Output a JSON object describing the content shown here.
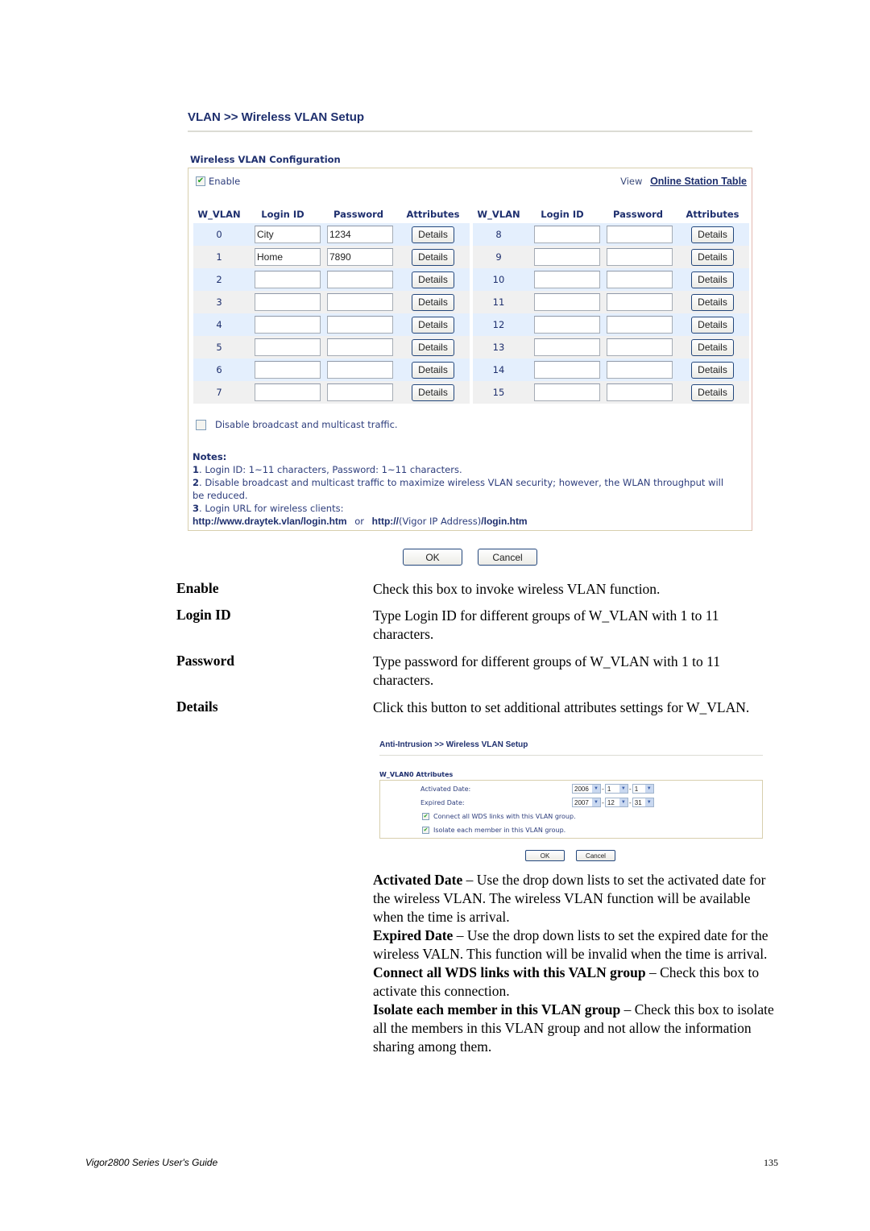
{
  "screenshot1": {
    "title": "VLAN >> Wireless VLAN Setup",
    "section_title": "Wireless VLAN Configuration",
    "enable": {
      "label": "Enable",
      "checked": true
    },
    "view_label": "View",
    "online_station_link": "Online Station Table",
    "columns": [
      "W_VLAN",
      "Login ID",
      "Password",
      "Attributes"
    ],
    "details_label": "Details",
    "left_rows": [
      {
        "id": "0",
        "login": "City",
        "password": "1234"
      },
      {
        "id": "1",
        "login": "Home",
        "password": "7890"
      },
      {
        "id": "2",
        "login": "",
        "password": ""
      },
      {
        "id": "3",
        "login": "",
        "password": ""
      },
      {
        "id": "4",
        "login": "",
        "password": ""
      },
      {
        "id": "5",
        "login": "",
        "password": ""
      },
      {
        "id": "6",
        "login": "",
        "password": ""
      },
      {
        "id": "7",
        "login": "",
        "password": ""
      }
    ],
    "right_rows": [
      {
        "id": "8",
        "login": "",
        "password": ""
      },
      {
        "id": "9",
        "login": "",
        "password": ""
      },
      {
        "id": "10",
        "login": "",
        "password": ""
      },
      {
        "id": "11",
        "login": "",
        "password": ""
      },
      {
        "id": "12",
        "login": "",
        "password": ""
      },
      {
        "id": "13",
        "login": "",
        "password": ""
      },
      {
        "id": "14",
        "login": "",
        "password": ""
      },
      {
        "id": "15",
        "login": "",
        "password": ""
      }
    ],
    "disable_broadcast": {
      "label": "Disable broadcast and multicast traffic.",
      "checked": false
    },
    "notes": {
      "heading": "Notes:",
      "items": [
        {
          "num": "1",
          "text": ". Login ID: 1~11 characters, Password: 1~11 characters."
        },
        {
          "num": "2",
          "text": ". Disable broadcast and multicast traffic to maximize wireless VLAN security; however, the WLAN throughput will be reduced."
        },
        {
          "num": "3",
          "text": ". Login URL for wireless clients:"
        }
      ],
      "url1": "http://www.draytek.vlan/login.htm",
      "or": "or",
      "url2_prefix": "http://",
      "url2_middle": "(Vigor IP Address)",
      "url2_suffix": "/login.htm"
    },
    "ok_label": "OK",
    "cancel_label": "Cancel"
  },
  "definitions": [
    {
      "term": "Enable",
      "desc": "Check this box to invoke wireless VLAN function."
    },
    {
      "term": "Login ID",
      "desc": "Type Login ID for different groups of W_VLAN with 1 to 11 characters."
    },
    {
      "term": "Password",
      "desc": "Type password for different groups of W_VLAN with 1 to 11 characters."
    },
    {
      "term": "Details",
      "desc": "Click this button to set additional attributes settings for W_VLAN."
    }
  ],
  "screenshot2": {
    "title": "Anti-Intrusion >> Wireless VLAN Setup",
    "section_title": "W_VLAN0 Attributes",
    "activated_label": "Activated Date:",
    "activated": {
      "year": "2006",
      "month": "1",
      "day": "1"
    },
    "expired_label": "Expired Date:",
    "expired": {
      "year": "2007",
      "month": "12",
      "day": "31"
    },
    "connect_wds": {
      "label": "Connect all WDS links with this VLAN group.",
      "checked": true
    },
    "isolate": {
      "label": "Isolate each member in this VLAN group.",
      "checked": true
    },
    "ok_label": "OK",
    "cancel_label": "Cancel"
  },
  "attribute_descriptions": [
    {
      "term": "Activated Date",
      "desc": " – Use the drop down lists to set the activated date for the wireless VLAN. The wireless VLAN function will be available when the time is arrival."
    },
    {
      "term": "Expired Date",
      "desc": " – Use the drop down lists to set the expired date for the wireless VALN. This function will be invalid when the time is arrival."
    },
    {
      "term": "Connect all WDS links with this VALN group",
      "desc": " – Check this box to activate this connection."
    },
    {
      "term": "Isolate each member in this VLAN group",
      "desc": " – Check this box to isolate all the members in this VLAN group and not allow the information sharing among them."
    }
  ],
  "footer": {
    "guide": "Vigor2800 Series User's Guide",
    "page": "135"
  }
}
